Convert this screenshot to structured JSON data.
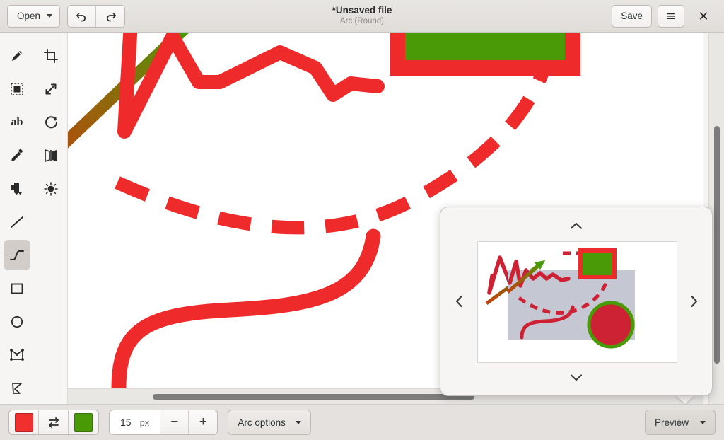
{
  "window": {
    "title": "*Unsaved file",
    "subtitle": "Arc (Round)"
  },
  "header": {
    "open_label": "Open",
    "save_label": "Save",
    "undo_name": "undo-button",
    "redo_name": "redo-button",
    "menu_name": "main-menu-button",
    "close_label": "✕"
  },
  "sidebar": {
    "tools": [
      {
        "name": "pencil-tool",
        "label": "Pencil"
      },
      {
        "name": "crop-tool",
        "label": "Crop"
      },
      {
        "name": "select-rectangle-tool",
        "label": "Rectangle select"
      },
      {
        "name": "resize-tool",
        "label": "Resize"
      },
      {
        "name": "text-tool",
        "label": "ab"
      },
      {
        "name": "rotate-tool",
        "label": "Rotate"
      },
      {
        "name": "color-picker-tool",
        "label": "Color picker"
      },
      {
        "name": "flip-tool",
        "label": "Flip"
      },
      {
        "name": "fill-tool",
        "label": "Fill"
      },
      {
        "name": "brightness-tool",
        "label": "Brightness"
      },
      {
        "name": "line-tool",
        "label": "Line"
      },
      {
        "name": "arc-tool",
        "label": "Arc",
        "selected": true
      },
      {
        "name": "rectangle-tool",
        "label": "Rectangle"
      },
      {
        "name": "ellipse-tool",
        "label": "Ellipse"
      },
      {
        "name": "polygon-tool",
        "label": "Polygon"
      },
      {
        "name": "freeform-tool",
        "label": "Free-form shape"
      }
    ]
  },
  "bottombar": {
    "primary_color": "#f0302f",
    "secondary_color": "#4a9a07",
    "swap_icon": "swap-colors-icon",
    "size_value": "15",
    "size_unit": "px",
    "decrease_label": "−",
    "increase_label": "+",
    "options_label": "Arc options",
    "preview_label": "Preview"
  },
  "popover": {
    "name": "preview-popover",
    "chevron_up": "⌃",
    "chevron_down": "⌄",
    "chevron_left": "‹",
    "chevron_right": "›",
    "thumbnail_name": "canvas-thumbnail",
    "viewport_color": "#c5c7d3"
  },
  "canvas": {
    "background": "#ffffff",
    "stroke_red": "#ee2a2a",
    "stroke_green": "#4a9a07",
    "shapes": [
      {
        "name": "red-zigzag-stroke",
        "color": "#ee2a2a"
      },
      {
        "name": "gradient-arrow",
        "from": "#4a9a07",
        "to": "#c44a0a"
      },
      {
        "name": "green-rectangle-with-red-border",
        "fill": "#4a9a07",
        "border": "#ee2a2a"
      },
      {
        "name": "red-dashed-arc",
        "color": "#ee2a2a"
      },
      {
        "name": "red-s-curve",
        "color": "#ee2a2a"
      },
      {
        "name": "red-circle-with-green-border",
        "fill": "#cc2234",
        "border": "#4a9a07"
      }
    ]
  }
}
